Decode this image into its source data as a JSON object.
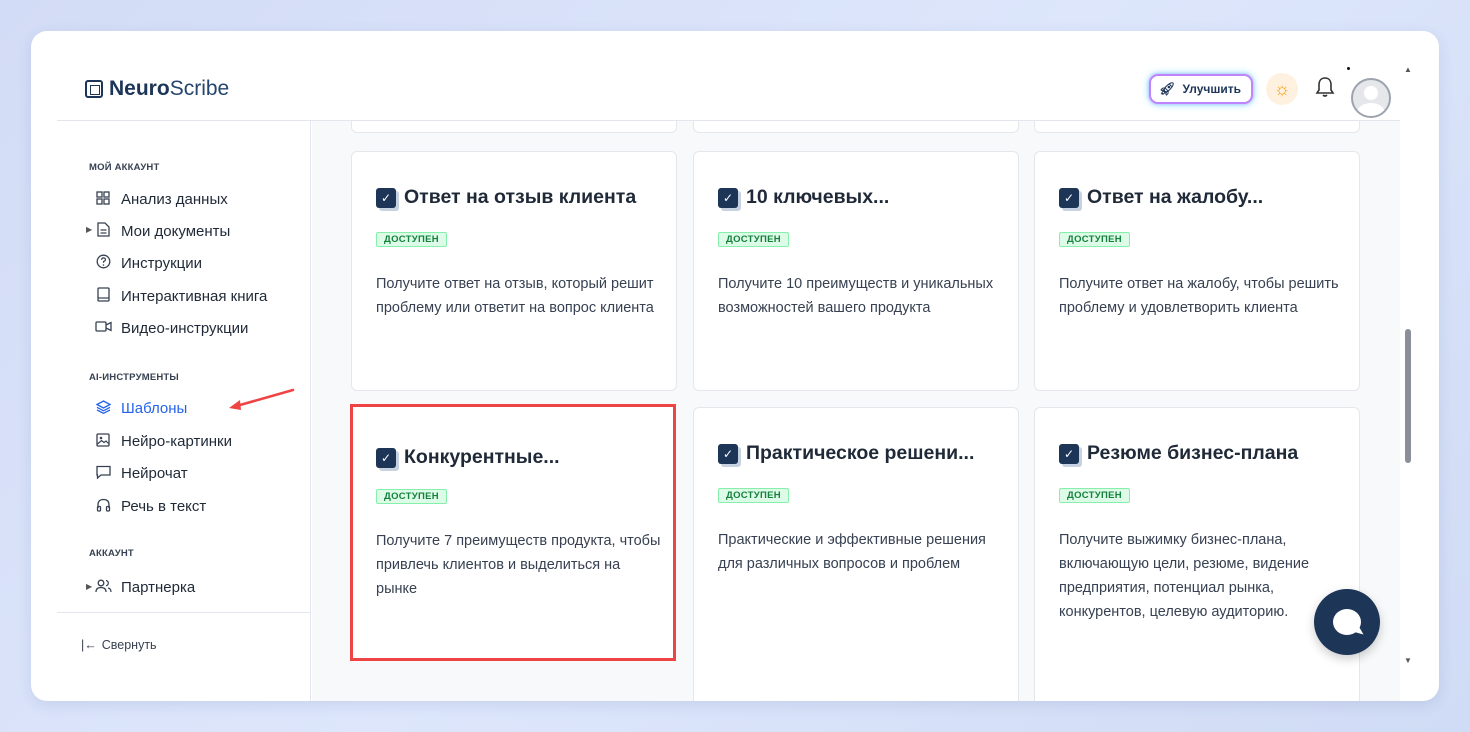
{
  "header": {
    "logo_bold": "Neuro",
    "logo_light": "Scribe",
    "upgrade_label": "Улучшить"
  },
  "sidebar": {
    "section_account": "МОЙ АККАУНТ",
    "account_items": [
      {
        "label": "Анализ данных",
        "icon": "grid-icon"
      },
      {
        "label": "Мои документы",
        "icon": "document-icon"
      },
      {
        "label": "Инструкции",
        "icon": "help-circle-icon"
      },
      {
        "label": "Интерактивная книга",
        "icon": "book-icon"
      },
      {
        "label": "Видео-инструкции",
        "icon": "video-icon"
      }
    ],
    "section_ai": "AI-ИНСТРУМЕНТЫ",
    "ai_items": [
      {
        "label": "Шаблоны",
        "icon": "layers-icon",
        "active": true
      },
      {
        "label": "Нейро-картинки",
        "icon": "image-icon"
      },
      {
        "label": "Нейрочат",
        "icon": "chat-icon"
      },
      {
        "label": "Речь в текст",
        "icon": "headphones-icon"
      }
    ],
    "section_acc2": "АККАУНТ",
    "acc2_items": [
      {
        "label": "Партнерка",
        "icon": "users-icon"
      }
    ],
    "collapse_label": "Свернуть"
  },
  "cards": [
    {
      "title": "Ответ на отзыв клиента",
      "badge": "ДОСТУПЕН",
      "desc": "Получите ответ на отзыв, который решит проблему или ответит на вопрос клиента"
    },
    {
      "title": "10 ключевых...",
      "badge": "ДОСТУПЕН",
      "desc": "Получите 10 преимуществ и уникальных возможностей вашего продукта"
    },
    {
      "title": "Ответ на жалобу...",
      "badge": "ДОСТУПЕН",
      "desc": "Получите ответ на жалобу, чтобы решить проблему и удовлетворить клиента"
    },
    {
      "title": "Конкурентные...",
      "badge": "ДОСТУПЕН",
      "desc": "Получите 7 преимуществ продукта, чтобы привлечь клиентов и выделиться на рынке"
    },
    {
      "title": "Практическое решени...",
      "badge": "ДОСТУПЕН",
      "desc": "Практические и эффективные решения для различных вопросов и проблем"
    },
    {
      "title": "Резюме бизнес-плана",
      "badge": "ДОСТУПЕН",
      "desc": "Получите выжимку бизнес-плана, включающую цели, резюме, видение предприятия, потенциал рынка, конкурентов, целевую аудиторию."
    }
  ],
  "colors": {
    "brand": "#1d3557",
    "active": "#2563eb",
    "badge_green": "#15803d",
    "highlight_red": "#ef4444"
  }
}
